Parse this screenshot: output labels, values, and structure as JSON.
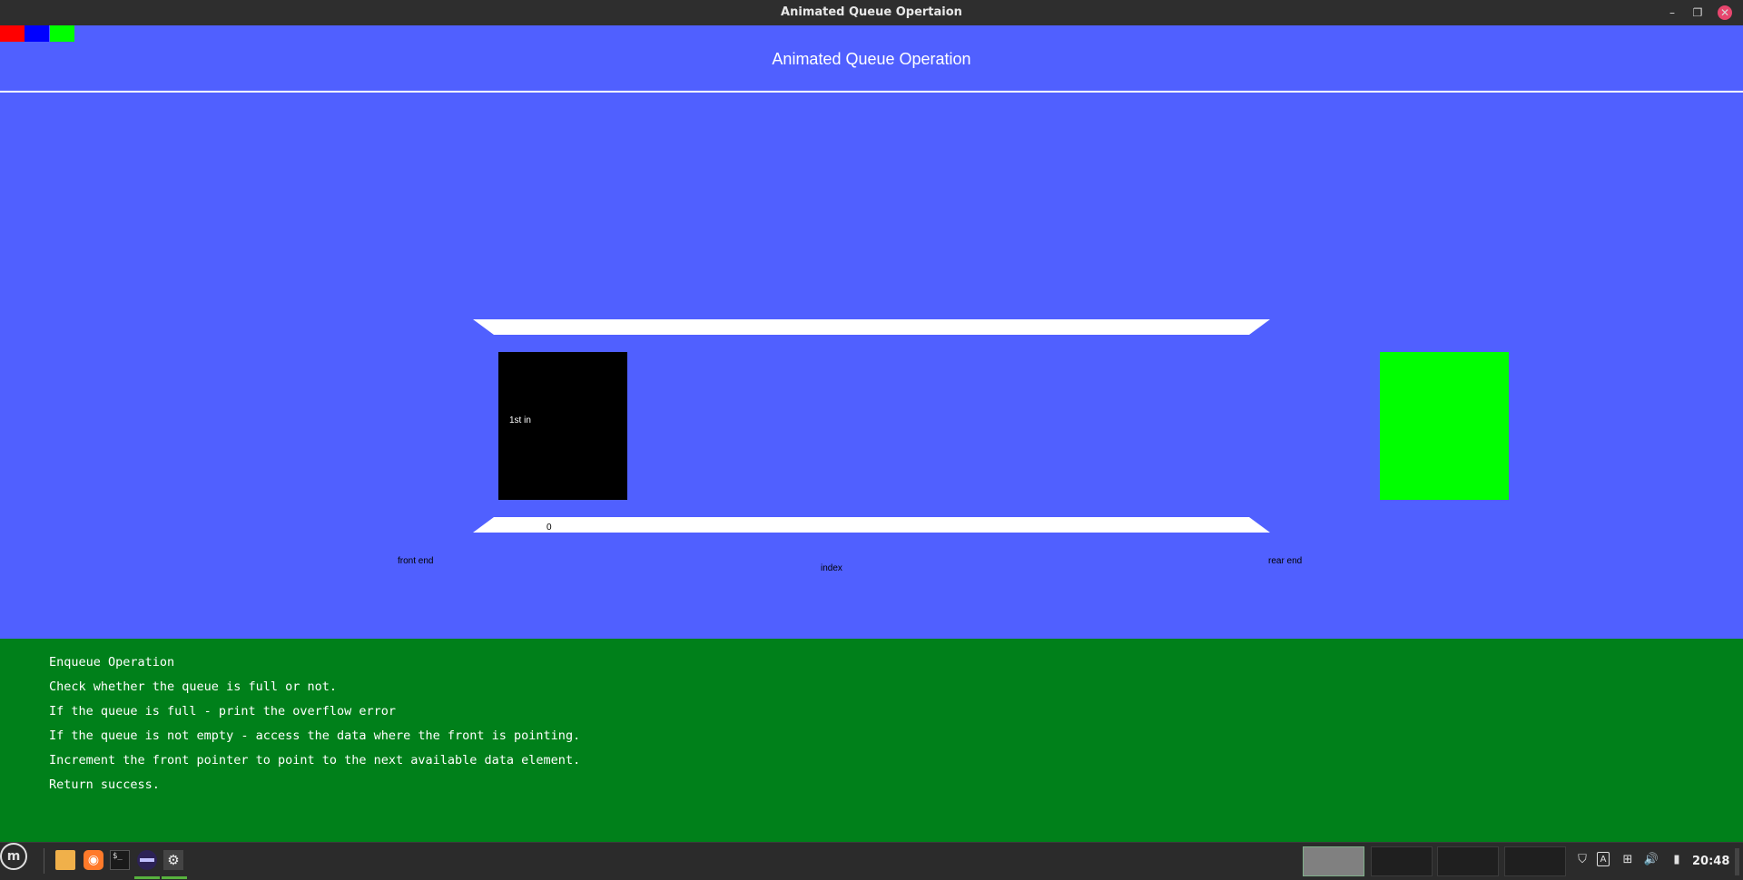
{
  "window": {
    "title": "Animated Queue Opertaion"
  },
  "header": {
    "title": "Animated Queue Operation"
  },
  "swatches": {
    "red": "#ff0000",
    "blue": "#0000ff",
    "green": "#00ff00"
  },
  "colors": {
    "stage": "#5060ff",
    "info_panel": "#00801a"
  },
  "queue": {
    "element_label": "1st in",
    "index_value": "0",
    "front_label": "front end",
    "index_label": "index",
    "rear_label": "rear end"
  },
  "info": {
    "lines": [
      "Enqueue Operation",
      "Check whether the queue is full or not.",
      "If the queue is full - print the overflow error",
      "If the queue is not empty - access the data where the front is pointing.",
      "Increment the front pointer to point to the next available data element.",
      "Return success."
    ]
  },
  "taskbar": {
    "clock": "20:48",
    "launchers": [
      "menu-icon",
      "files-icon",
      "firefox-icon",
      "terminal-icon",
      "eclipse-icon",
      "app-icon"
    ]
  }
}
